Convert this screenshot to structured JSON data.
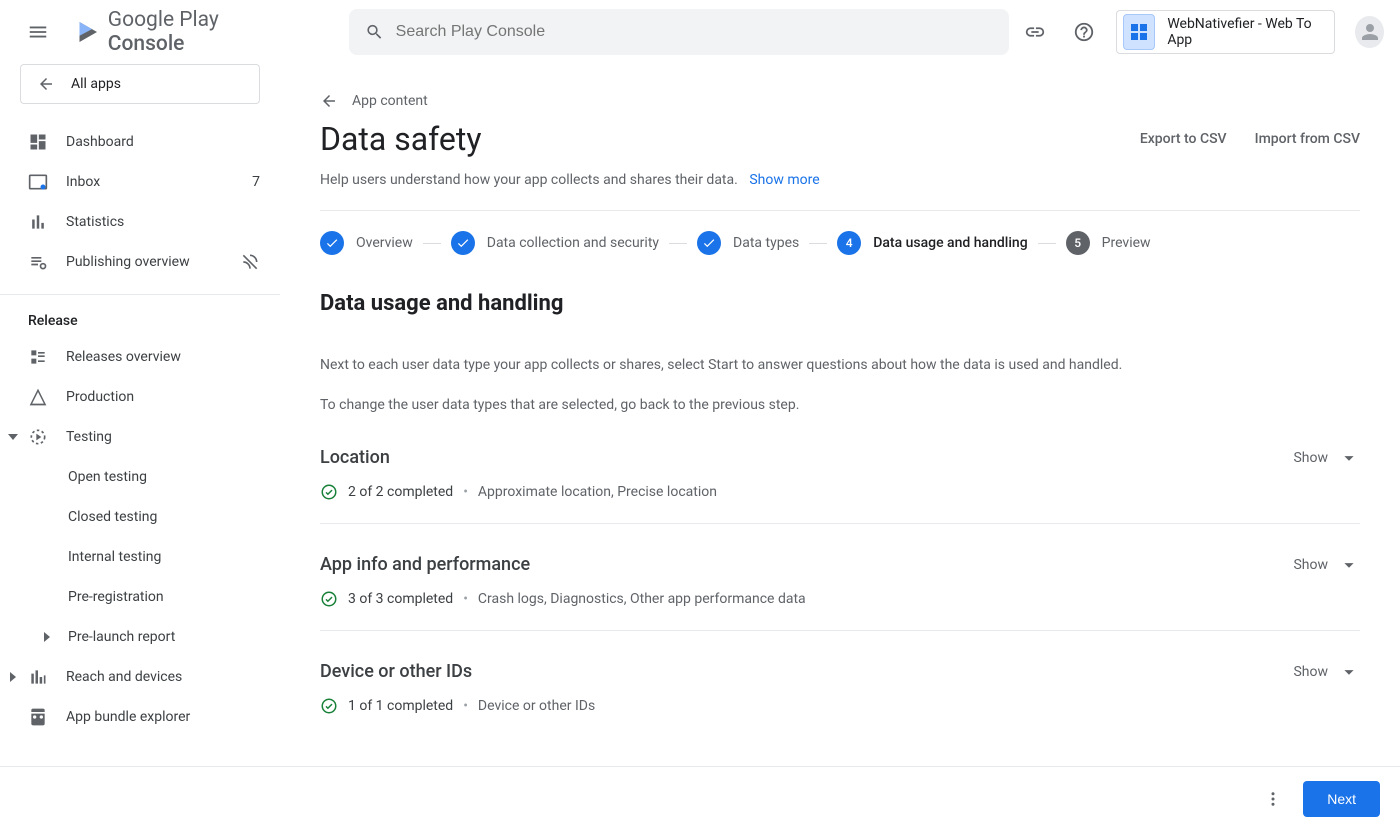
{
  "header": {
    "logo_primary": "Google Play",
    "logo_secondary": "Console",
    "search_placeholder": "Search Play Console",
    "app_name": "WebNativefier - Web To App"
  },
  "sidebar": {
    "all_apps": "All apps",
    "items": [
      {
        "label": "Dashboard"
      },
      {
        "label": "Inbox",
        "badge": "7"
      },
      {
        "label": "Statistics"
      },
      {
        "label": "Publishing overview",
        "trailing_icon": true
      }
    ],
    "section": "Release",
    "release_items": [
      {
        "label": "Releases overview"
      },
      {
        "label": "Production"
      },
      {
        "label": "Testing",
        "expanded": true,
        "caret": "down",
        "children": [
          {
            "label": "Open testing"
          },
          {
            "label": "Closed testing"
          },
          {
            "label": "Internal testing"
          },
          {
            "label": "Pre-registration"
          },
          {
            "label": "Pre-launch report",
            "caret": "right"
          }
        ]
      },
      {
        "label": "Reach and devices",
        "caret": "right"
      },
      {
        "label": "App bundle explorer"
      }
    ]
  },
  "main": {
    "breadcrumb": "App content",
    "title": "Data safety",
    "export": "Export to CSV",
    "import": "Import from CSV",
    "description": "Help users understand how your app collects and shares their data.",
    "show_more": "Show more",
    "steps": [
      {
        "label": "Overview",
        "state": "done"
      },
      {
        "label": "Data collection and security",
        "state": "done"
      },
      {
        "label": "Data types",
        "state": "done"
      },
      {
        "label": "Data usage and handling",
        "state": "current",
        "num": "4"
      },
      {
        "label": "Preview",
        "state": "pending",
        "num": "5"
      }
    ],
    "section_title": "Data usage and handling",
    "section_p1": "Next to each user data type your app collects or shares, select Start to answer questions about how the data is used and handled.",
    "section_p2": "To change the user data types that are selected, go back to the previous step.",
    "groups": [
      {
        "title": "Location",
        "completed": "2 of 2 completed",
        "detail": "Approximate location, Precise location",
        "toggle": "Show"
      },
      {
        "title": "App info and performance",
        "completed": "3 of 3 completed",
        "detail": "Crash logs, Diagnostics, Other app performance data",
        "toggle": "Show"
      },
      {
        "title": "Device or other IDs",
        "completed": "1 of 1 completed",
        "detail": "Device or other IDs",
        "toggle": "Show"
      }
    ]
  },
  "footer": {
    "next": "Next"
  }
}
